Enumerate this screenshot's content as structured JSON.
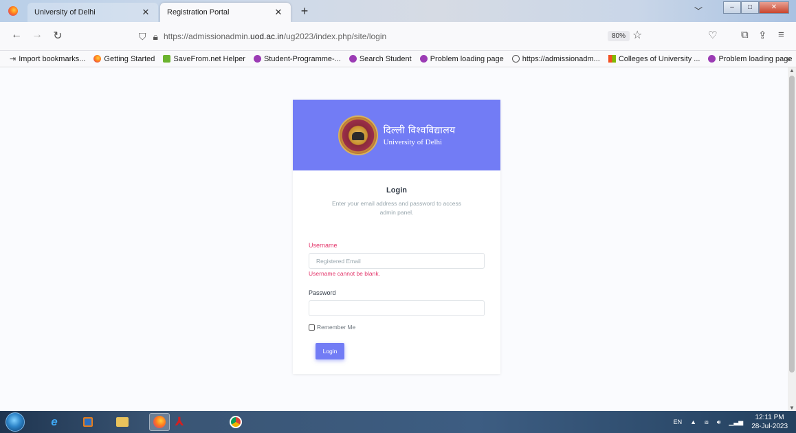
{
  "browser": {
    "tabs": [
      {
        "label": "University of Delhi",
        "active": false
      },
      {
        "label": "Registration Portal",
        "active": true
      }
    ],
    "url_prefix": "https://admissionadmin.",
    "url_domain": "uod.ac.in",
    "url_path": "/ug2023/index.php/site/login",
    "zoom": "80%",
    "bookmarks": [
      {
        "label": "Import bookmarks...",
        "icon": "import-icon"
      },
      {
        "label": "Getting Started",
        "icon": "firefox-icon"
      },
      {
        "label": "SaveFrom.net Helper",
        "icon": "download-icon"
      },
      {
        "label": "Student-Programme-...",
        "icon": "purple-circle-icon"
      },
      {
        "label": "Search Student",
        "icon": "purple-circle-icon"
      },
      {
        "label": "Problem loading page",
        "icon": "purple-circle-icon"
      },
      {
        "label": "https://admissionadm...",
        "icon": "globe-icon"
      },
      {
        "label": "Colleges of University ...",
        "icon": "tiles-icon"
      },
      {
        "label": "Problem loading page",
        "icon": "purple-circle-icon"
      }
    ]
  },
  "page": {
    "brand_hindi": "दिल्ली विश्वविद्यालय",
    "brand_english": "University of Delhi",
    "login_title": "Login",
    "login_subtitle": "Enter your email address and password to access admin panel.",
    "username_label": "Username",
    "username_placeholder": "Registered Email",
    "username_error": "Username cannot be blank.",
    "password_label": "Password",
    "remember_label": "Remember Me",
    "login_button": "Login",
    "colors": {
      "primary": "#727cf5",
      "error": "#e3366b"
    }
  },
  "taskbar": {
    "language": "EN",
    "time": "12:11 PM",
    "date": "28-Jul-2023"
  }
}
